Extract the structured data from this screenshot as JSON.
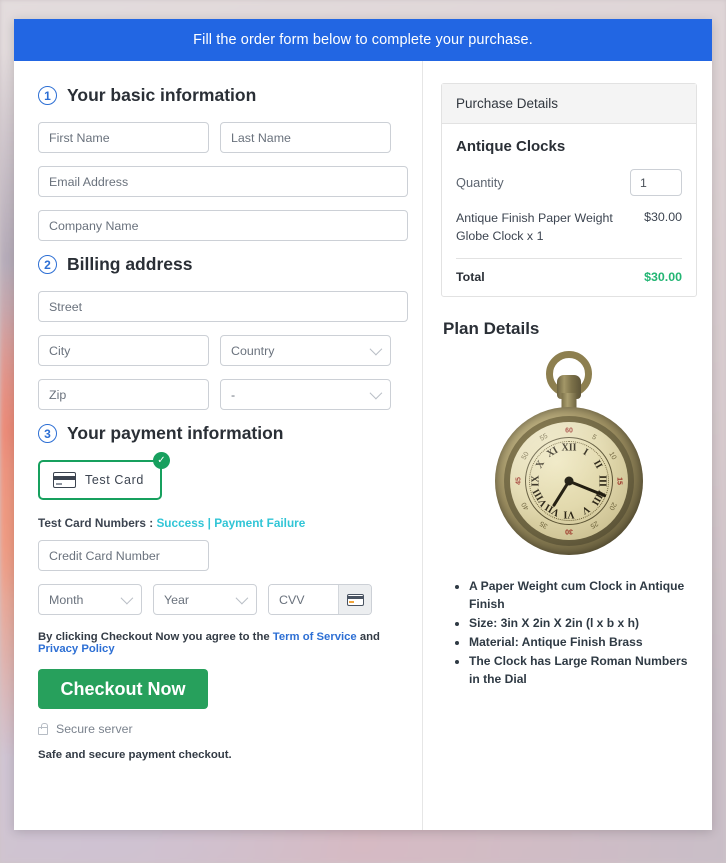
{
  "banner": {
    "text": "Fill the order form below to complete your purchase."
  },
  "steps": {
    "basic": {
      "num": "1",
      "title": "Your basic information"
    },
    "billing": {
      "num": "2",
      "title": "Billing address"
    },
    "payment": {
      "num": "3",
      "title": "Your payment information"
    }
  },
  "fields": {
    "first_name": "First Name",
    "last_name": "Last Name",
    "email": "Email Address",
    "company": "Company Name",
    "street": "Street",
    "city": "City",
    "country": "Country",
    "zip": "Zip",
    "state": "-",
    "card_number": "Credit Card Number",
    "month": "Month",
    "year": "Year",
    "cvv": "CVV"
  },
  "payment": {
    "test_card_label": "Test Card",
    "test_card_selected": true,
    "badge_icon": "check-icon",
    "card_icon": "credit-card-icon",
    "numbers_prefix": "Test Card Numbers : ",
    "success_link": "Success",
    "separator": " | ",
    "failure_link": "Payment Failure"
  },
  "terms": {
    "prefix": "By clicking Checkout Now you agree to the ",
    "tos": "Term of Service",
    "conjunction": " and ",
    "privacy": "Privacy Policy"
  },
  "actions": {
    "checkout": "Checkout Now",
    "secure_server": "Secure server",
    "safe_note": "Safe and secure payment checkout."
  },
  "purchase": {
    "panel_title": "Purchase Details",
    "product": "Antique Clocks",
    "quantity_label": "Quantity",
    "quantity_value": "1",
    "line_item": "Antique Finish Paper Weight Globe Clock x 1",
    "line_price": "$30.00",
    "total_label": "Total",
    "total_value": "$30.00"
  },
  "plan": {
    "title": "Plan Details",
    "image_alt": "antique-pocket-watch-image",
    "bullets": [
      "A Paper Weight cum Clock in Antique Finish",
      "Size: 3in X 2in X 2in (l x b x h)",
      "Material: Antique Finish Brass",
      "The Clock has Large Roman Numbers in the Dial"
    ]
  },
  "clock_face": {
    "roman_numerals": [
      "XII",
      "I",
      "II",
      "III",
      "IIII",
      "V",
      "VI",
      "VII",
      "VIII",
      "IX",
      "X",
      "XI"
    ],
    "minute_marks": [
      "60",
      "5",
      "10",
      "15",
      "20",
      "25",
      "30",
      "35",
      "40",
      "45",
      "50",
      "55"
    ]
  },
  "colors": {
    "banner_blue": "#2266e3",
    "step_blue": "#2d6fd4",
    "green": "#27a05c",
    "total_green": "#22b573",
    "link_teal": "#31c5d6",
    "link_blue": "#2d6fd4"
  }
}
